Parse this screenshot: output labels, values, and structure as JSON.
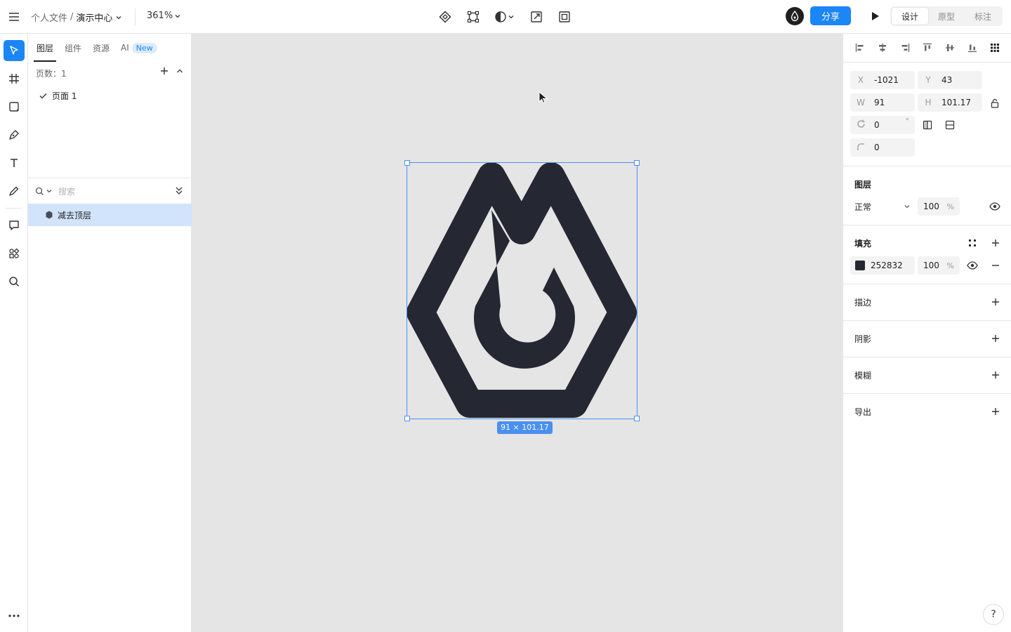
{
  "topbar": {
    "breadcrumb_parent": "个人文件",
    "breadcrumb_sep": "/",
    "doc_title": "演示中心",
    "zoom": "361%",
    "share_label": "分享",
    "modes": [
      "设计",
      "原型",
      "标注"
    ],
    "active_mode": "设计"
  },
  "left_panel": {
    "tabs": [
      "图层",
      "组件",
      "资源",
      "AI"
    ],
    "ai_badge": "New",
    "pages_count": "页数：1",
    "pages": [
      "页面 1"
    ],
    "search_placeholder": "搜索",
    "layers": [
      "减去顶层"
    ]
  },
  "canvas": {
    "selection_size": "91 × 101.17",
    "fill_color": "#252832",
    "background": "#e5e5e5",
    "selection_color": "#4a90f0"
  },
  "design_panel": {
    "x_label": "X",
    "x_value": "-1021",
    "y_label": "Y",
    "y_value": "43",
    "w_label": "W",
    "w_value": "91",
    "h_label": "H",
    "h_value": "101.17",
    "rotation_value": "0",
    "rotation_unit": "°",
    "radius_value": "0",
    "layer_title": "图层",
    "blend_mode": "正常",
    "opacity_value": "100",
    "opacity_unit": "%",
    "fill_title": "填充",
    "fill_hex": "252832",
    "fill_opacity": "100",
    "fill_unit": "%",
    "stroke_title": "描边",
    "shadow_title": "阴影",
    "blur_title": "模糊",
    "export_title": "导出"
  },
  "colors": {
    "accent": "#1b86f5",
    "layer_highlight": "#d2e4fb"
  },
  "help_label": "?"
}
